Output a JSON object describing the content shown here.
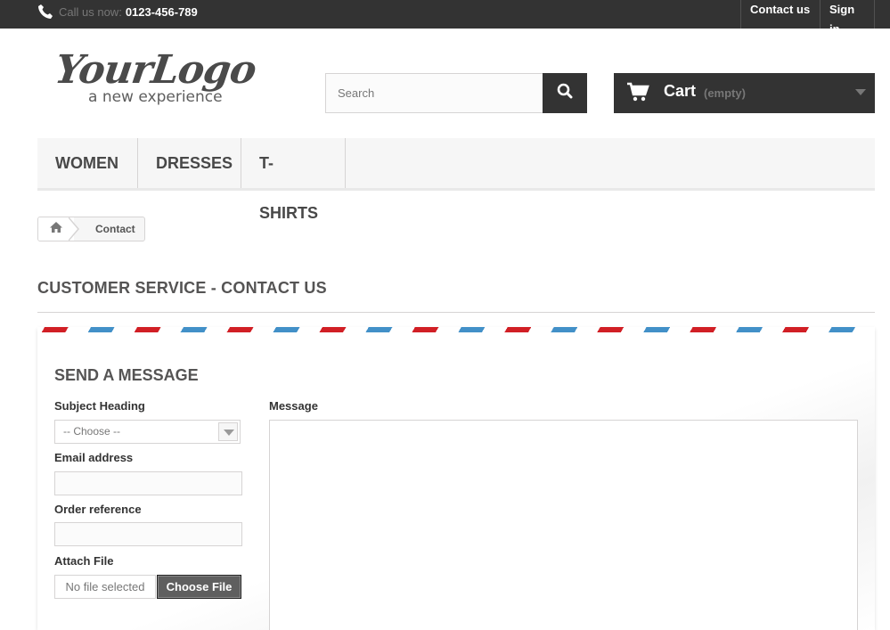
{
  "topbar": {
    "call_label": "Call us now:",
    "phone_number": "0123-456-789",
    "contact_link": "Contact us",
    "signin_link": "Sign in"
  },
  "logo": {
    "main": "YourLogo",
    "tagline": "a new experience"
  },
  "search": {
    "placeholder": "Search",
    "icon": "search-icon"
  },
  "cart": {
    "label": "Cart",
    "status": "(empty)",
    "icon": "shopping-cart-icon"
  },
  "menu": {
    "items": [
      "WOMEN",
      "DRESSES",
      "T-SHIRTS"
    ]
  },
  "breadcrumb": {
    "home_icon": "home-icon",
    "current": "Contact"
  },
  "page": {
    "heading": "CUSTOMER SERVICE - CONTACT US"
  },
  "form": {
    "title": "SEND A MESSAGE",
    "subject_label": "Subject Heading",
    "subject_selected": "-- Choose --",
    "email_label": "Email address",
    "email_value": "",
    "order_label": "Order reference",
    "order_value": "",
    "attach_label": "Attach File",
    "file_status": "No file selected",
    "file_button": "Choose File",
    "message_label": "Message",
    "message_value": ""
  },
  "colors": {
    "dark": "#333333",
    "stripe_blue": "#4290c8",
    "stripe_red": "#d11f25",
    "menu_bg": "#f6f6f6",
    "border": "#d6d4d4"
  }
}
